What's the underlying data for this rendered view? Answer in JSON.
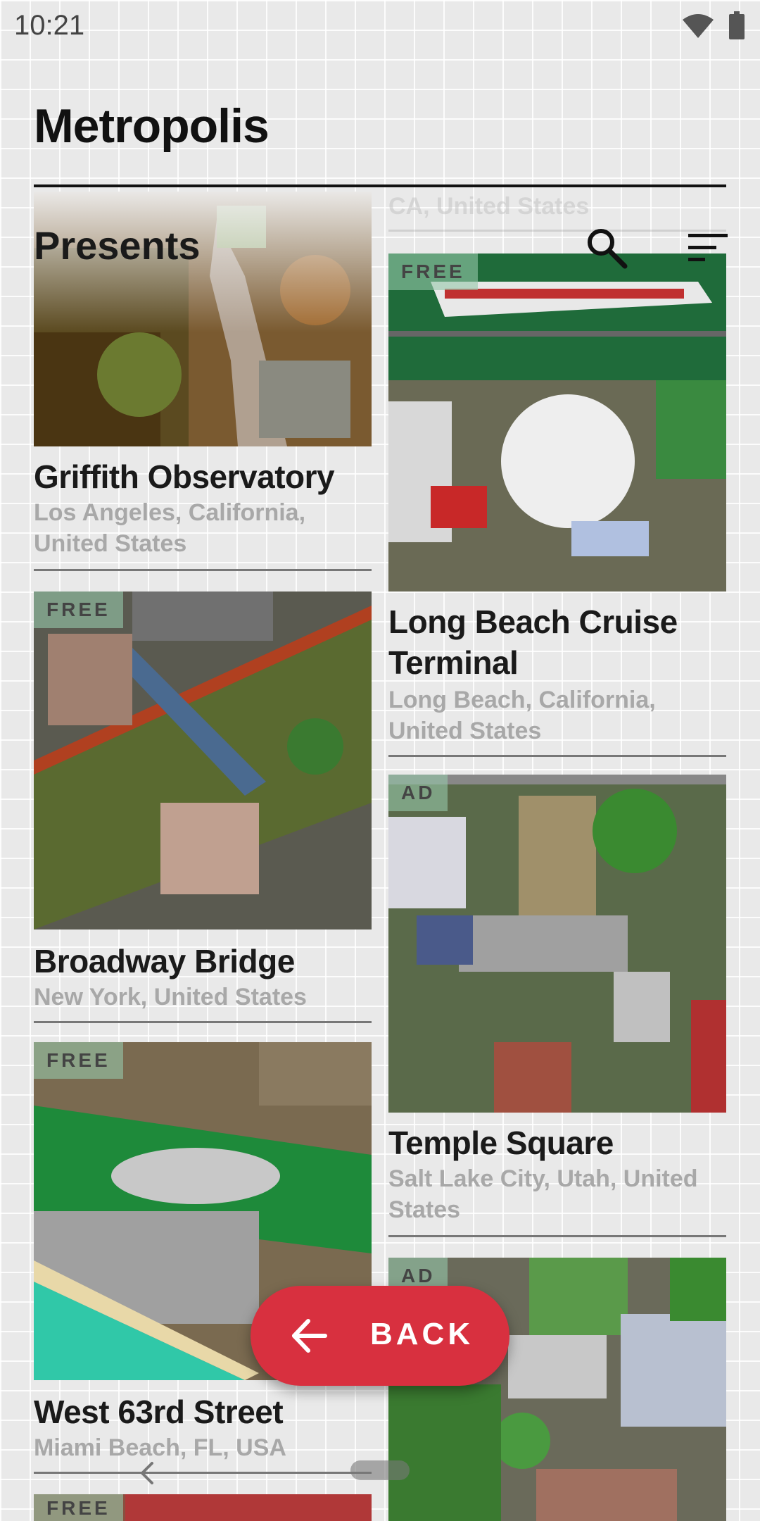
{
  "status_bar": {
    "time": "10:21",
    "wifi_icon": "wifi-icon",
    "battery_icon": "battery-icon"
  },
  "header": {
    "title": "Metropolis",
    "subtitle": "Presents"
  },
  "faded_location": "CA, United States",
  "cards": [
    {
      "title": "Griffith Observatory",
      "location": "Los Angeles, California, United States",
      "badge": ""
    },
    {
      "title": "Long Beach Cruise Terminal",
      "location": "Long Beach, California, United States",
      "badge": "FREE"
    },
    {
      "title": "Broadway Bridge",
      "location": "New York, United States",
      "badge": "FREE"
    },
    {
      "title": "Temple Square",
      "location": "Salt Lake City, Utah, United States",
      "badge": "AD"
    },
    {
      "title": "West 63rd Street",
      "location": "Miami Beach, FL, USA",
      "badge": "FREE"
    },
    {
      "title": "",
      "location": "",
      "badge": "AD"
    },
    {
      "title": "",
      "location": "",
      "badge": "FREE"
    }
  ],
  "fab": {
    "label": "BACK",
    "color": "#d8303f"
  },
  "colors": {
    "accent": "#d8303f",
    "text": "#1a1a1a",
    "muted": "#a8a8a8"
  }
}
